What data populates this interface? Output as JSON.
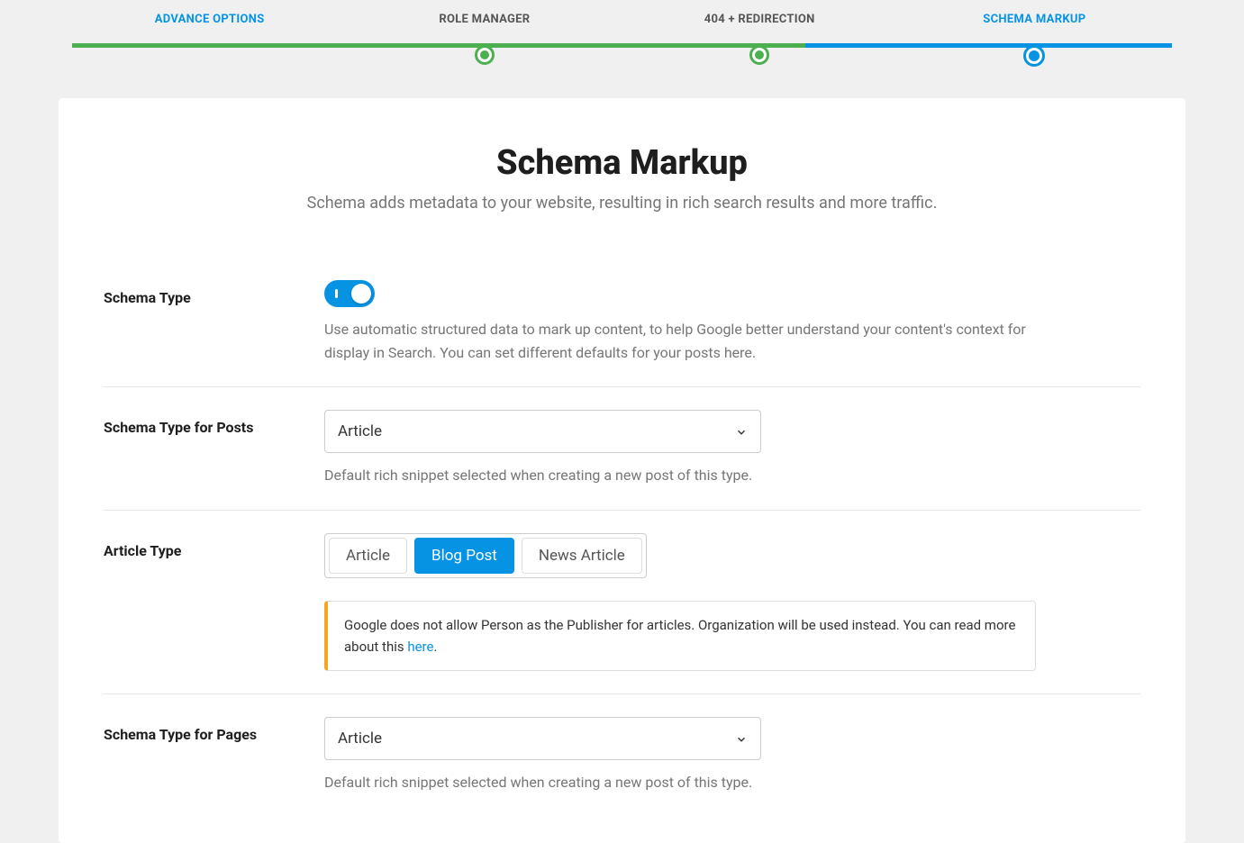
{
  "stepper": {
    "steps": [
      {
        "label": "ADVANCE OPTIONS"
      },
      {
        "label": "ROLE MANAGER"
      },
      {
        "label": "404 + REDIRECTION"
      },
      {
        "label": "SCHEMA MARKUP"
      }
    ]
  },
  "page": {
    "title": "Schema Markup",
    "subtitle": "Schema adds metadata to your website, resulting in rich search results and more traffic."
  },
  "settings": {
    "schemaType": {
      "label": "Schema Type",
      "helper": "Use automatic structured data to mark up content, to help Google better understand your content's context for display in Search. You can set different defaults for your posts here."
    },
    "schemaTypePosts": {
      "label": "Schema Type for Posts",
      "value": "Article",
      "helper": "Default rich snippet selected when creating a new post of this type."
    },
    "articleType": {
      "label": "Article Type",
      "options": [
        {
          "label": "Article"
        },
        {
          "label": "Blog Post"
        },
        {
          "label": "News Article"
        }
      ],
      "alertText": "Google does not allow Person as the Publisher for articles. Organization will be used instead. You can read more about this ",
      "alertLink": "here",
      "alertPeriod": "."
    },
    "schemaTypePages": {
      "label": "Schema Type for Pages",
      "value": "Article",
      "helper": "Default rich snippet selected when creating a new post of this type."
    }
  }
}
